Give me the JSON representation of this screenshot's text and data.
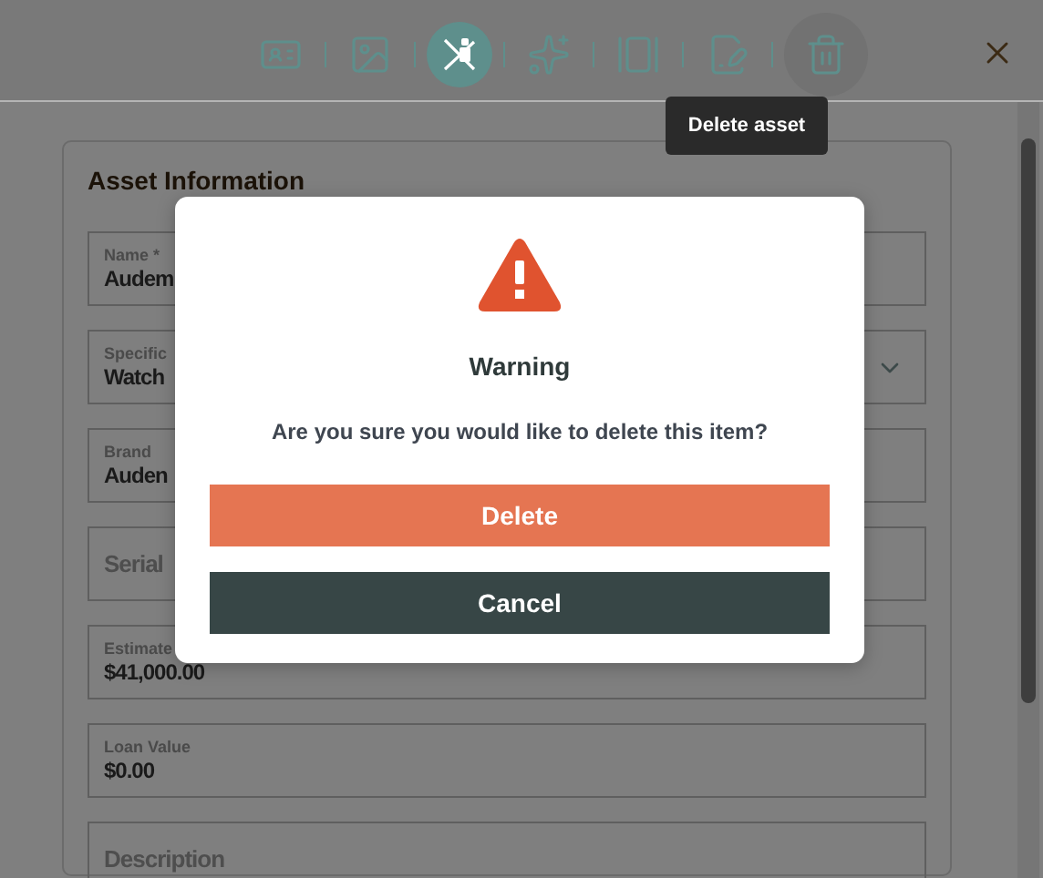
{
  "toolbar": [
    {
      "kind": "id-card",
      "selected": false,
      "hovered": false
    },
    {
      "kind": "image",
      "selected": false,
      "hovered": false
    },
    {
      "kind": "crossed",
      "selected": true,
      "hovered": false
    },
    {
      "kind": "sparkles",
      "selected": false,
      "hovered": false
    },
    {
      "kind": "gallery",
      "selected": false,
      "hovered": false
    },
    {
      "kind": "edit",
      "selected": false,
      "hovered": false
    },
    {
      "kind": "trash",
      "selected": false,
      "hovered": true
    }
  ],
  "tooltip": "Delete asset",
  "card": {
    "title": "Asset Information",
    "fields": [
      {
        "kind": "filled",
        "label": "Name *",
        "value": "Audem"
      },
      {
        "kind": "select",
        "label": "Specific",
        "value": "Watch"
      },
      {
        "kind": "filled",
        "label": "Brand",
        "value": "Auden"
      },
      {
        "kind": "empty",
        "placeholder": "Serial"
      },
      {
        "kind": "filled",
        "label": "Estimate",
        "value": "$41,000.00"
      },
      {
        "kind": "filled",
        "label": "Loan Value",
        "value": "$0.00"
      },
      {
        "kind": "empty",
        "placeholder": "Description"
      }
    ]
  },
  "dialog": {
    "title": "Warning",
    "message": "Are you sure you would like to delete this item?",
    "buttons": [
      {
        "kind": "danger",
        "label": "Delete"
      },
      {
        "kind": "secondary",
        "label": "Cancel"
      }
    ]
  }
}
